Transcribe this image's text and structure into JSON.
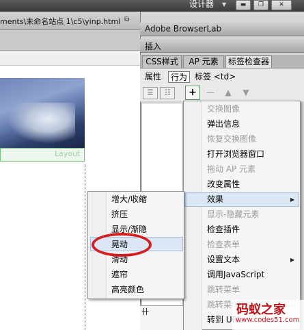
{
  "titlebar": {
    "workspace_label": "设计器",
    "minimize": "▬",
    "restore": "❐",
    "close": "✕"
  },
  "document": {
    "path": "ments\\未命名站点 1\\c5\\yinp.html",
    "ghost_text": "Layout"
  },
  "panels": {
    "browserlab_title": "Adobe BrowserLab",
    "insert_title": "插入",
    "tabs": [
      "CSS样式",
      "AP 元素",
      "标签检查器"
    ],
    "subtabs": {
      "attributes": "属性",
      "behaviors": "行为",
      "tag_label": "标签 <td>"
    },
    "bottom_glyph": "卄"
  },
  "behaviors_menu": {
    "items": [
      {
        "label": "交换图像",
        "enabled": false
      },
      {
        "label": "弹出信息",
        "enabled": true
      },
      {
        "label": "恢复交换图像",
        "enabled": false
      },
      {
        "label": "打开浏览器窗口",
        "enabled": true
      },
      {
        "label": "拖动 AP 元素",
        "enabled": false
      },
      {
        "label": "改变属性",
        "enabled": true
      },
      {
        "label": "效果",
        "enabled": true,
        "submenu": true
      },
      {
        "label": "显示-隐藏元素",
        "enabled": false
      },
      {
        "label": "检查插件",
        "enabled": true
      },
      {
        "label": "检查表单",
        "enabled": false
      },
      {
        "label": "设置文本",
        "enabled": true,
        "submenu": true
      },
      {
        "label": "调用JavaScript",
        "enabled": true
      },
      {
        "label": "跳转菜单",
        "enabled": false
      },
      {
        "label": "跳转菜单开始",
        "enabled": false
      },
      {
        "label": "转到 URL",
        "enabled": true
      }
    ]
  },
  "effects_submenu": {
    "items": [
      "增大/收缩",
      "挤压",
      "显示/渐隐",
      "晃动",
      "滑动",
      "遮帘",
      "高亮颜色"
    ],
    "highlighted": "晃动"
  },
  "watermark": {
    "title": "码蚁之家",
    "url": "www.codes51.com"
  },
  "colors": {
    "annotation": "#d31f1f",
    "menu_highlight": "#dbe7f4"
  }
}
